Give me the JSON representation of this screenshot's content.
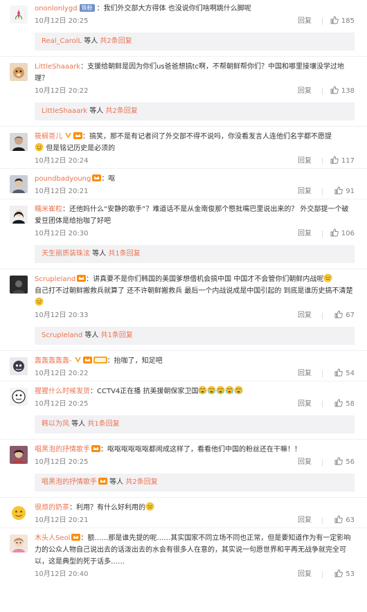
{
  "comments": [
    {
      "user": "ononlonlygd",
      "badge": "铁粉",
      "text": "：我们外交部大方得体 也没说你们啥啊跳什么脚呢",
      "time": "10月12日 20:25",
      "reply": "回复",
      "likes": "185",
      "thread": {
        "user": "Real_CarolL",
        "mid": " 等人 ",
        "count": "共2条回复"
      }
    },
    {
      "user": "LittleShaaark",
      "text": "：支援给朝鲜是因为你们us爸爸想搞tc啊，不帮朝鲜帮你们？中国和哪里接壤没学过地理？",
      "time": "10月12日 20:22",
      "reply": "回复",
      "likes": "138",
      "thread": {
        "user": "LittleShaaark",
        "mid": " 等人 ",
        "count": "共2条回复"
      }
    },
    {
      "user": "筱榈哥儿",
      "text": "：搞笑，那不是有记者问了外交部不得不说吗，你没看发言人连他们名字都不愿提",
      "text2": "但是铭记历史是必须的",
      "time": "10月12日 20:24",
      "reply": "回复",
      "likes": "117"
    },
    {
      "user": "poundbadyoung",
      "text": "：呕",
      "time": "10月12日 20:21",
      "reply": "回复",
      "likes": "91"
    },
    {
      "user": "糯米崔粒",
      "text": "：还他妈什么“安静的歌手”？难道话不是从金南俊那个愍批嘴巴里说出来的？ 外交部提一个破爱豆团体是给抬咖了好吧",
      "time": "10月12日 20:30",
      "reply": "回复",
      "likes": "106",
      "thread": {
        "user": "天生丽质装珠泫",
        "mid": " 等人 ",
        "count": "共1条回复"
      }
    },
    {
      "user": "Scrupleland",
      "text": "：讲真要不是你们韩国的美国爹想借机会搞中国 中国才不会管你们朝鲜内战呢",
      "text2": "自己打不过朝鲜搬救兵就算了 还不许朝鲜搬救兵 最后一个内战说成是中国引起的 到底是谁历史搞不清楚",
      "time": "10月12日 20:33",
      "reply": "回复",
      "likes": "67",
      "thread": {
        "user": "Scrupleland",
        "mid": " 等人 ",
        "count": "共1条回复"
      }
    },
    {
      "user": "轰轰轰轰轰-",
      "text": "：抬咖了，知足吧",
      "time": "10月12日 20:22",
      "reply": "回复",
      "likes": "54"
    },
    {
      "user": "猩猩什么时候发货",
      "text": "：CCTV4正在播 抗美援朝保家卫国",
      "time": "10月12日 20:25",
      "reply": "回复",
      "likes": "58",
      "thread": {
        "user": "韩以为风",
        "mid": " 等人 ",
        "count": "共1条回复"
      }
    },
    {
      "user": "唱黑泡的抒情歌手",
      "text": "：呕呕呕呕呕呕都闹成这样了，看看他们中国的粉丝还在干嘛！！",
      "time": "10月12日 20:25",
      "reply": "回复",
      "likes": "56",
      "thread": {
        "user": "唱黑泡的抒情歌手",
        "mid": " 等人 ",
        "count": "共2条回复"
      }
    },
    {
      "user": "很烦的奶茶",
      "text": "：利用？有什么好利用的",
      "time": "10月12日 20:21",
      "reply": "回复",
      "likes": "63"
    },
    {
      "user": "木头人Seol",
      "text": "：额……那是谁先提的呢……其实国家不同立场不同也正常，但是要知道作为有一定影响力的公众人物自己说出去的话泼出去的水会有很多人在意的，其实说一句愿世界和平再无战争就完全可以，这是典型的死于话多……",
      "time": "10月12日 20:40",
      "reply": "回复",
      "likes": "53"
    }
  ],
  "colors": {
    "username": "#eb7350",
    "meta": "#808080",
    "thread_bg": "#f2f2f5"
  }
}
